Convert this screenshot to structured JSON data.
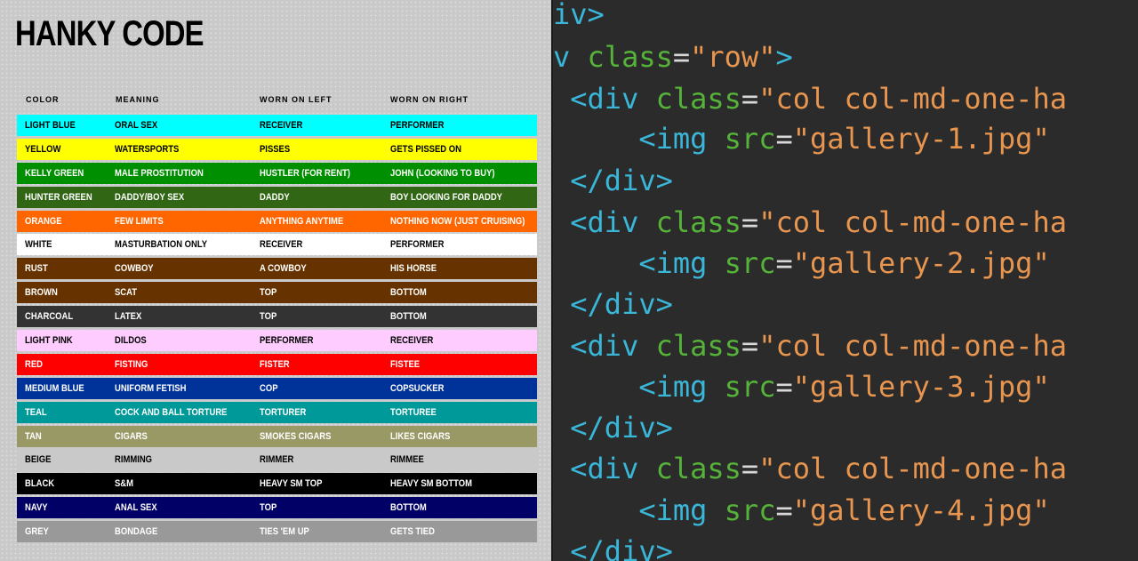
{
  "left": {
    "title": "HANKY CODE",
    "headers": [
      "COLOR",
      "MEANING",
      "WORN ON LEFT",
      "WORN ON RIGHT"
    ],
    "rows": [
      {
        "color": "LIGHT BLUE",
        "meaning": "ORAL SEX",
        "left": "RECEIVER",
        "right": "PERFORMER",
        "bg": "#00ffff",
        "fg": "#000000"
      },
      {
        "color": "YELLOW",
        "meaning": "WATERSPORTS",
        "left": "PISSES",
        "right": "GETS PISSED ON",
        "bg": "#ffff00",
        "fg": "#000000"
      },
      {
        "color": "KELLY GREEN",
        "meaning": "MALE PROSTITUTION",
        "left": "HUSTLER (FOR RENT)",
        "right": "JOHN (LOOKING TO BUY)",
        "bg": "#008f00",
        "fg": "#ffffff"
      },
      {
        "color": "HUNTER GREEN",
        "meaning": "DADDY/BOY SEX",
        "left": "DADDY",
        "right": "BOY LOOKING FOR DADDY",
        "bg": "#306614",
        "fg": "#ffffff"
      },
      {
        "color": "ORANGE",
        "meaning": "FEW LIMITS",
        "left": "ANYTHING ANYTIME",
        "right": "NOTHING NOW (JUST CRUISING)",
        "bg": "#ff6600",
        "fg": "#ffffff"
      },
      {
        "color": "WHITE",
        "meaning": "MASTURBATION ONLY",
        "left": "RECEIVER",
        "right": "PERFORMER",
        "bg": "#ffffff",
        "fg": "#000000"
      },
      {
        "color": "RUST",
        "meaning": "COWBOY",
        "left": "A COWBOY",
        "right": "HIS HORSE",
        "bg": "#663300",
        "fg": "#ffffff"
      },
      {
        "color": "BROWN",
        "meaning": "SCAT",
        "left": "TOP",
        "right": "BOTTOM",
        "bg": "#663300",
        "fg": "#ffffff"
      },
      {
        "color": "CHARCOAL",
        "meaning": "LATEX",
        "left": "TOP",
        "right": "BOTTOM",
        "bg": "#333333",
        "fg": "#ffffff"
      },
      {
        "color": "LIGHT PINK",
        "meaning": "DILDOS",
        "left": "PERFORMER",
        "right": "RECEIVER",
        "bg": "#ffccff",
        "fg": "#000000"
      },
      {
        "color": "RED",
        "meaning": "FISTING",
        "left": "FISTER",
        "right": "FISTEE",
        "bg": "#ff0000",
        "fg": "#ffffff"
      },
      {
        "color": "MEDIUM BLUE",
        "meaning": "UNIFORM FETISH",
        "left": "COP",
        "right": "COPSUCKER",
        "bg": "#003399",
        "fg": "#ffffff"
      },
      {
        "color": "TEAL",
        "meaning": "COCK AND BALL TORTURE",
        "left": "TORTURER",
        "right": "TORTUREE",
        "bg": "#009999",
        "fg": "#ffffff"
      },
      {
        "color": "TAN",
        "meaning": "CIGARS",
        "left": "SMOKES CIGARS",
        "right": "LIKES CIGARS",
        "bg": "#999966",
        "fg": "#ffffff"
      },
      {
        "color": "BEIGE",
        "meaning": "RIMMING",
        "left": "RIMMER",
        "right": "RIMMEE",
        "bg": "#c9c9c9",
        "fg": "#000000"
      },
      {
        "color": "BLACK",
        "meaning": "S&M",
        "left": "HEAVY SM TOP",
        "right": "HEAVY SM BOTTOM",
        "bg": "#000000",
        "fg": "#ffffff"
      },
      {
        "color": "NAVY",
        "meaning": "ANAL SEX",
        "left": "TOP",
        "right": "BOTTOM",
        "bg": "#000066",
        "fg": "#ffffff"
      },
      {
        "color": "GREY",
        "meaning": "BONDAGE",
        "left": "TIES 'EM UP",
        "right": "GETS TIED",
        "bg": "#999999",
        "fg": "#ffffff"
      }
    ]
  },
  "code": {
    "lines": [
      [
        [
          "tag",
          "iv>"
        ]
      ],
      [
        [
          "tag",
          "v "
        ],
        [
          "attr",
          "class"
        ],
        [
          "eq",
          "="
        ],
        [
          "str",
          "\"row\""
        ],
        [
          "tag",
          ">"
        ]
      ],
      [
        [
          "tag",
          " <div "
        ],
        [
          "attr",
          "class"
        ],
        [
          "eq",
          "="
        ],
        [
          "str",
          "\"col col-md-one-ha"
        ]
      ],
      [
        [
          "tag",
          "     <img "
        ],
        [
          "attr",
          "src"
        ],
        [
          "eq",
          "="
        ],
        [
          "str",
          "\"gallery-1.jpg\""
        ]
      ],
      [
        [
          "tag",
          " </div>"
        ]
      ],
      [
        [
          "tag",
          " <div "
        ],
        [
          "attr",
          "class"
        ],
        [
          "eq",
          "="
        ],
        [
          "str",
          "\"col col-md-one-ha"
        ]
      ],
      [
        [
          "tag",
          "     <img "
        ],
        [
          "attr",
          "src"
        ],
        [
          "eq",
          "="
        ],
        [
          "str",
          "\"gallery-2.jpg\""
        ]
      ],
      [
        [
          "tag",
          " </div>"
        ]
      ],
      [
        [
          "tag",
          " <div "
        ],
        [
          "attr",
          "class"
        ],
        [
          "eq",
          "="
        ],
        [
          "str",
          "\"col col-md-one-ha"
        ]
      ],
      [
        [
          "tag",
          "     <img "
        ],
        [
          "attr",
          "src"
        ],
        [
          "eq",
          "="
        ],
        [
          "str",
          "\"gallery-3.jpg\""
        ]
      ],
      [
        [
          "tag",
          " </div>"
        ]
      ],
      [
        [
          "tag",
          " <div "
        ],
        [
          "attr",
          "class"
        ],
        [
          "eq",
          "="
        ],
        [
          "str",
          "\"col col-md-one-ha"
        ]
      ],
      [
        [
          "tag",
          "     <img "
        ],
        [
          "attr",
          "src"
        ],
        [
          "eq",
          "="
        ],
        [
          "str",
          "\"gallery-4.jpg\""
        ]
      ],
      [
        [
          "tag",
          " </div>"
        ]
      ]
    ]
  }
}
